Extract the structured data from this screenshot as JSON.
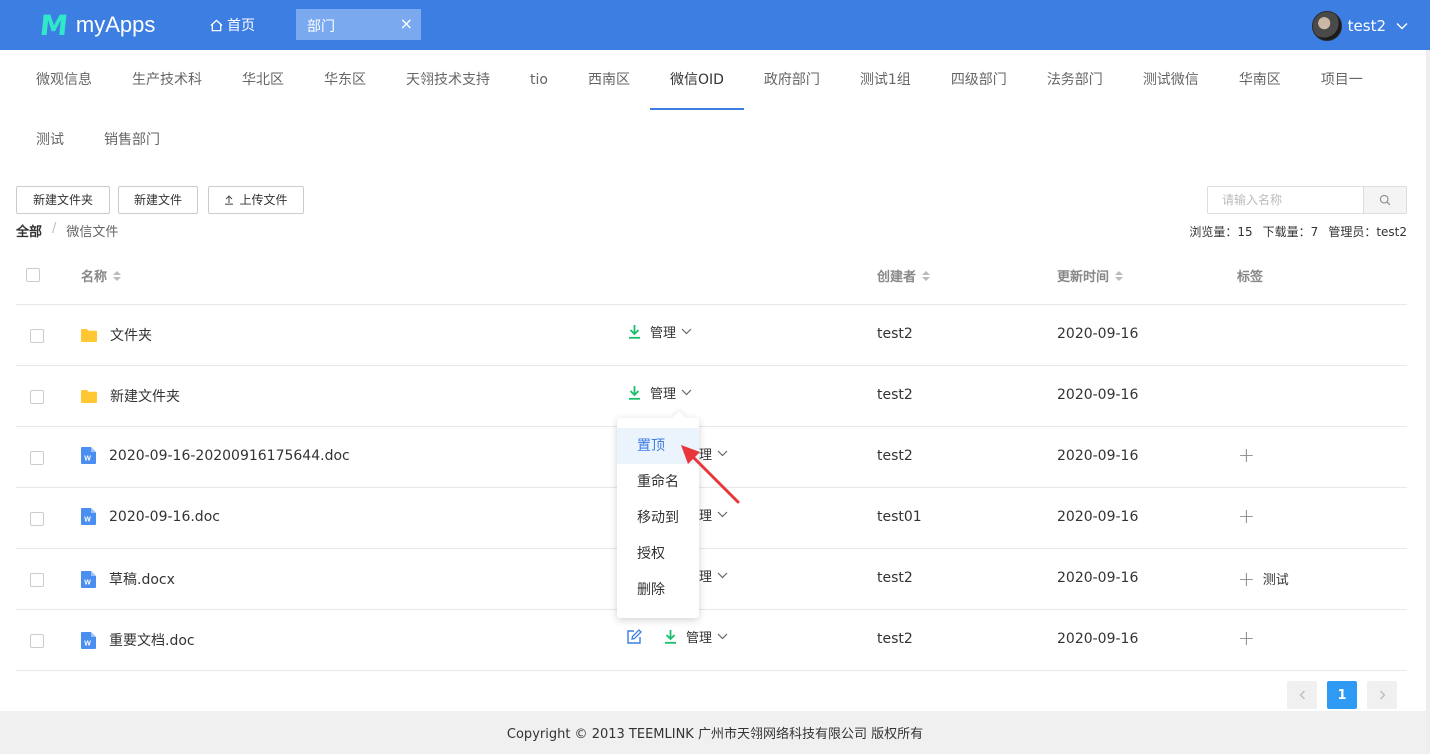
{
  "header": {
    "logo_mark": "M",
    "app_name": "myApps",
    "home_label": "首页",
    "open_tab": "部门",
    "open_tab_close": "×",
    "user_name": "test2"
  },
  "dept_tabs": {
    "row1": [
      "微观信息",
      "生产技术科",
      "华北区",
      "华东区",
      "天翎技术支持",
      "tio",
      "西南区",
      "微信OID",
      "政府部门",
      "测试1组",
      "四级部门",
      "法务部门",
      "测试微信",
      "华南区",
      "项目一"
    ],
    "row2": [
      "测试",
      "销售部门"
    ],
    "active": "微信OID"
  },
  "toolbar": {
    "new_folder": "新建文件夹",
    "new_file": "新建文件",
    "upload": "上传文件",
    "search_placeholder": "请输入名称"
  },
  "breadcrumb": {
    "root": "全部",
    "separator": "/",
    "current": "微信文件"
  },
  "stats": {
    "views": "浏览量：15",
    "downloads": "下载量：7",
    "admin": "管理员：test2"
  },
  "table": {
    "columns": {
      "name": "名称",
      "creator": "创建者",
      "updated": "更新时间",
      "tags": "标签"
    },
    "manage_label": "管理",
    "rows": [
      {
        "type": "folder",
        "name": "文件夹",
        "creator": "test2",
        "updated": "2020-09-16",
        "tag": ""
      },
      {
        "type": "folder",
        "name": "新建文件夹",
        "creator": "test2",
        "updated": "2020-09-16",
        "tag": ""
      },
      {
        "type": "doc",
        "name": "2020-09-16-20200916175644.doc",
        "creator": "test2",
        "updated": "2020-09-16",
        "tag": ""
      },
      {
        "type": "doc",
        "name": "2020-09-16.doc",
        "creator": "test01",
        "updated": "2020-09-16",
        "tag": ""
      },
      {
        "type": "doc",
        "name": "草稿.docx",
        "creator": "test2",
        "updated": "2020-09-16",
        "tag": "测试"
      },
      {
        "type": "doc",
        "name": "重要文档.doc",
        "creator": "test2",
        "updated": "2020-09-16",
        "tag": ""
      }
    ]
  },
  "dropdown": {
    "items": [
      "置顶",
      "重命名",
      "移动到",
      "授权",
      "删除"
    ],
    "hovered": "置顶"
  },
  "pagination": {
    "current": "1"
  },
  "footer": {
    "text": "Copyright © 2013 TEEMLINK 广州市天翎网络科技有限公司 版权所有"
  },
  "colors": {
    "header_bg": "#3d7ee3",
    "accent": "#3d7ee3",
    "download_green": "#19be6b",
    "folder_yellow": "#ffc832",
    "doc_blue": "#4a8ef0",
    "annotation_red": "#e8363a"
  }
}
